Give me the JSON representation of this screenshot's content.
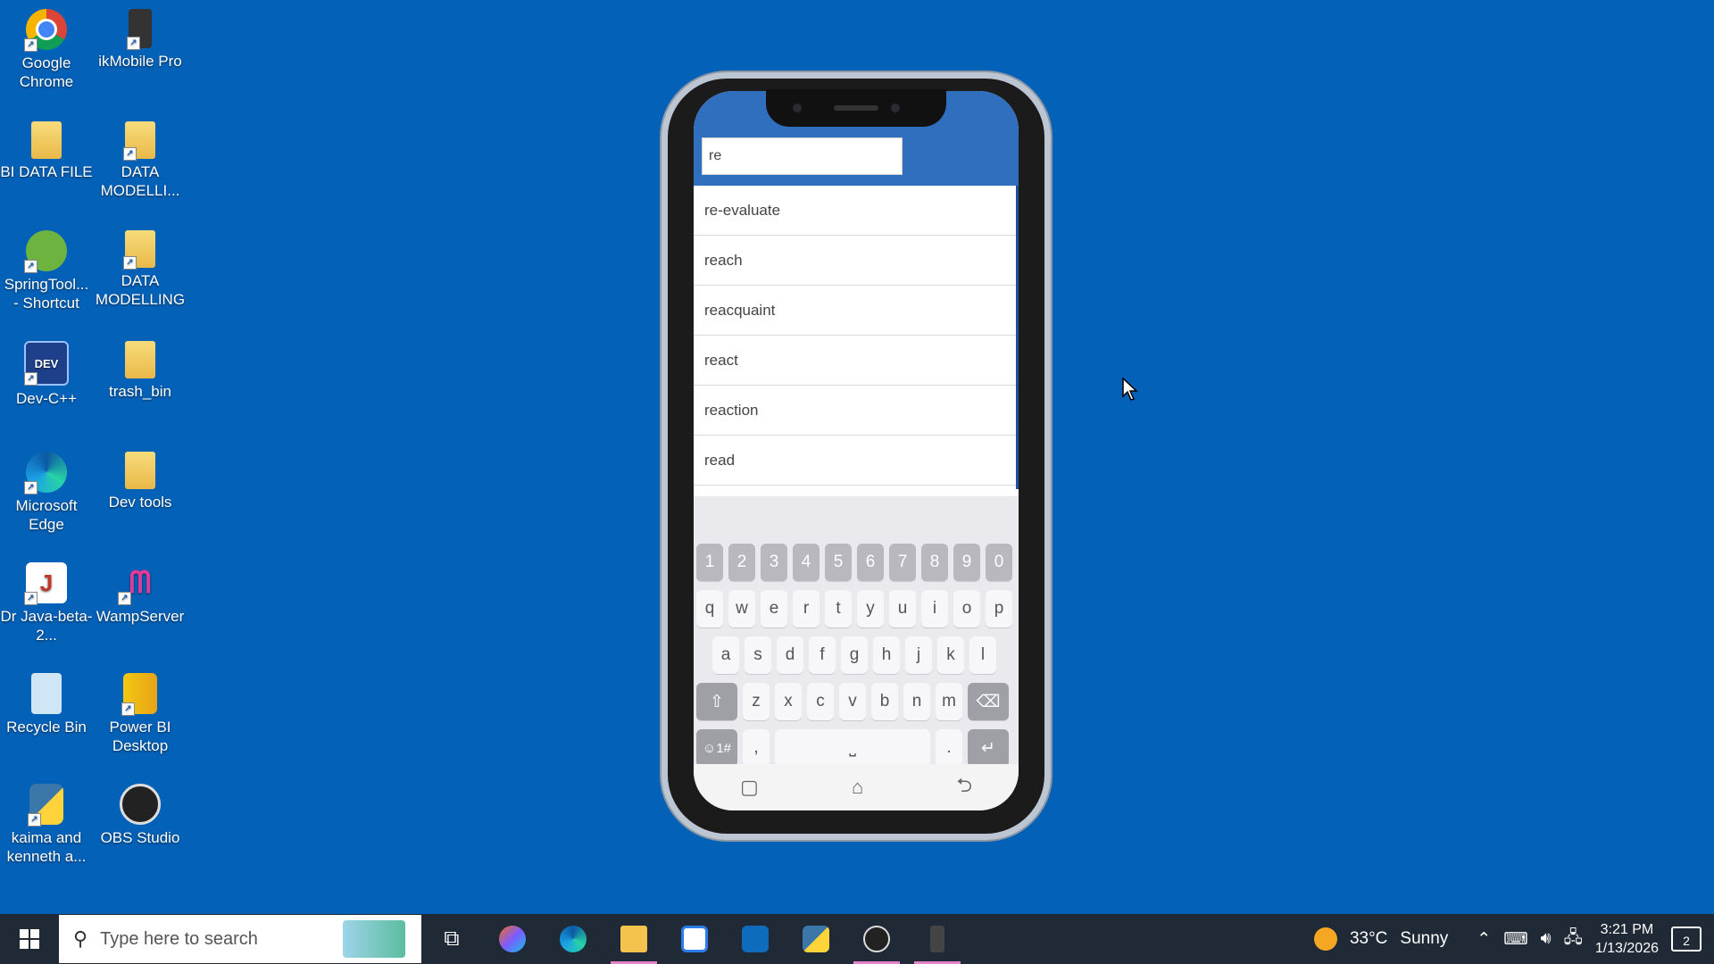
{
  "desktop": {
    "icons": [
      {
        "label": "Google Chrome",
        "icon": "chrome-icon"
      },
      {
        "label": "ikMobile Pro",
        "icon": "phone-app-icon"
      },
      {
        "label": "BI DATA FILE",
        "icon": "folder-icon"
      },
      {
        "label": "DATA MODELLI...",
        "icon": "folder-icon"
      },
      {
        "label": "SpringTool... - Shortcut",
        "icon": "spring-tool-icon"
      },
      {
        "label": "DATA MODELLING",
        "icon": "folder-icon"
      },
      {
        "label": "Dev-C++",
        "icon": "dev-cpp-icon"
      },
      {
        "label": "trash_bin",
        "icon": "folder-icon"
      },
      {
        "label": "Microsoft Edge",
        "icon": "edge-icon"
      },
      {
        "label": "Dev tools",
        "icon": "folder-icon"
      },
      {
        "label": "Dr Java-beta-2...",
        "icon": "drjava-icon"
      },
      {
        "label": "WampServer",
        "icon": "wampserver-icon"
      },
      {
        "label": "Recycle Bin",
        "icon": "recycle-bin-icon"
      },
      {
        "label": "Power BI Desktop",
        "icon": "power-bi-icon"
      },
      {
        "label": "kaima and kenneth a...",
        "icon": "python-file-icon"
      },
      {
        "label": "OBS Studio",
        "icon": "obs-icon"
      }
    ]
  },
  "phone": {
    "search": {
      "value": "re"
    },
    "suggestions": [
      "re-evaluate",
      "reach",
      "reacquaint",
      "react",
      "reaction",
      "read"
    ],
    "keyboard": {
      "numbers": [
        "1",
        "2",
        "3",
        "4",
        "5",
        "6",
        "7",
        "8",
        "9",
        "0"
      ],
      "row1": [
        "q",
        "w",
        "e",
        "r",
        "t",
        "y",
        "u",
        "i",
        "o",
        "p"
      ],
      "row2": [
        "a",
        "s",
        "d",
        "f",
        "g",
        "h",
        "j",
        "k",
        "l"
      ],
      "row3": [
        "z",
        "x",
        "c",
        "v",
        "b",
        "n",
        "m"
      ],
      "symbols_label": "☺1#",
      "comma": ",",
      "period": "."
    }
  },
  "taskbar": {
    "search_placeholder": "Type here to search",
    "weather": {
      "temp": "33°C",
      "condition": "Sunny"
    },
    "time": "3:21 PM",
    "date": "1/13/2026",
    "notifications": "2"
  },
  "colors": {
    "desktop_bg": "#0361b7",
    "app_header": "#2f6fbe",
    "taskbar": "#202a36"
  }
}
